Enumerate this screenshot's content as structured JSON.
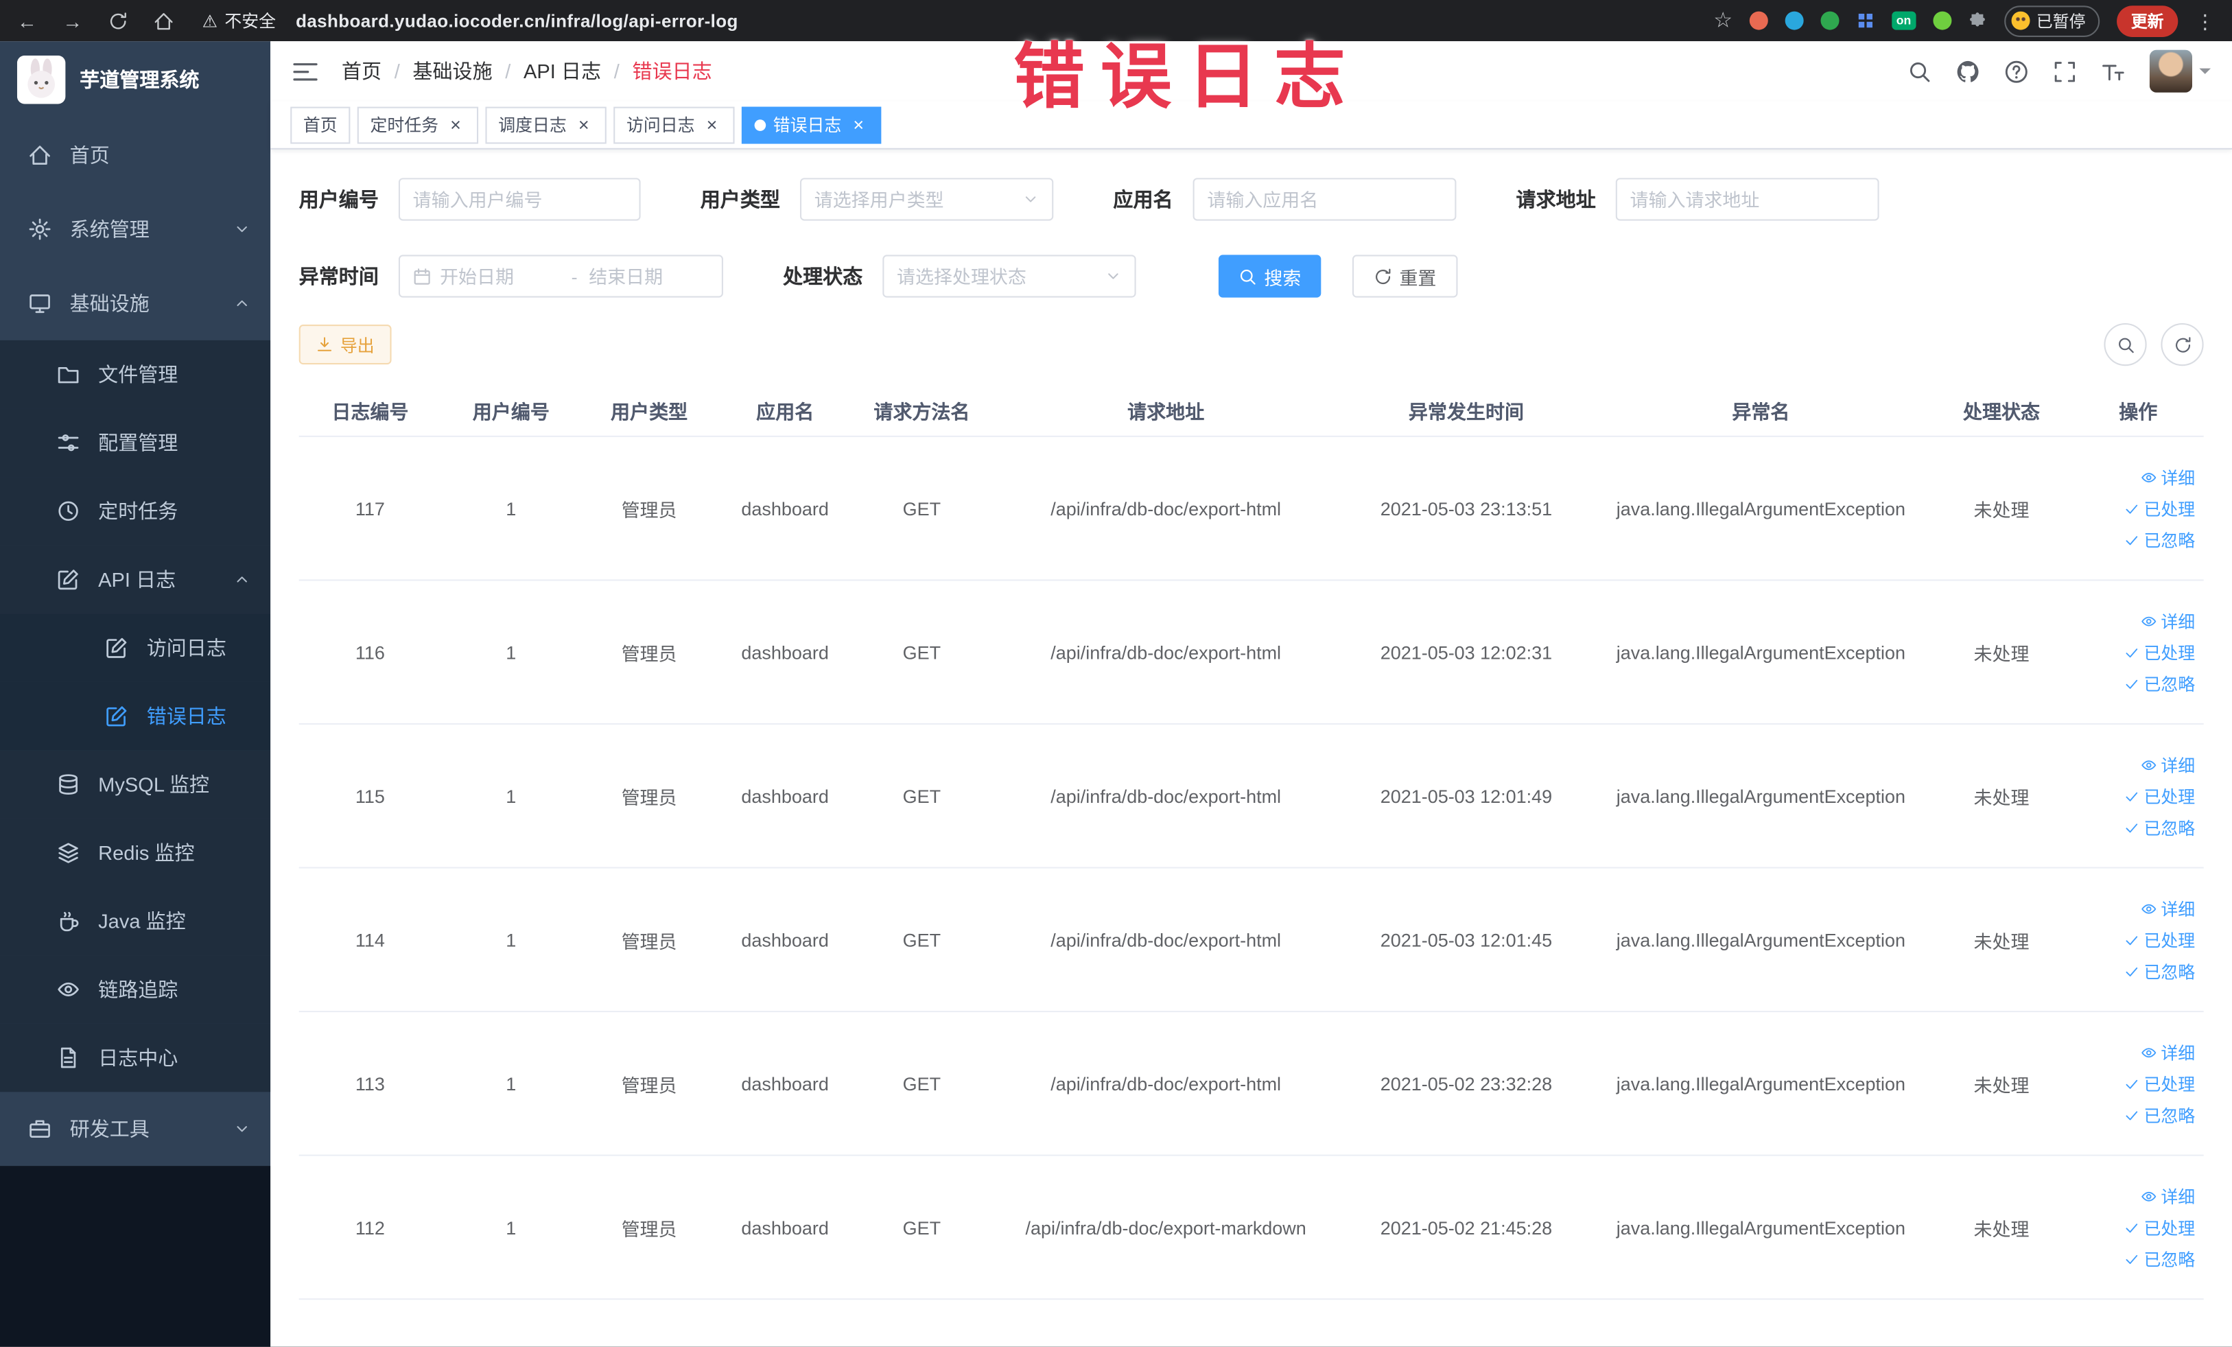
{
  "icons": {
    "back": "←",
    "forward": "→",
    "star": "☆",
    "warning": "⚠",
    "kebab": "⋮",
    "close": "×",
    "slash": "/"
  },
  "browser": {
    "security_label": "不安全",
    "url": "dashboard.yudao.iocoder.cn/infra/log/api-error-log",
    "paused_chip": "已暂停",
    "update_button": "更新",
    "on_badge": "on"
  },
  "overlay_title": "错误日志",
  "sidebar": {
    "logo_title": "芋道管理系统",
    "items": [
      {
        "label": "首页",
        "icon": "home-icon"
      },
      {
        "label": "系统管理",
        "icon": "gear-icon"
      },
      {
        "label": "基础设施",
        "icon": "monitor-icon"
      },
      {
        "label": "文件管理",
        "icon": "folder-icon"
      },
      {
        "label": "配置管理",
        "icon": "sliders-icon"
      },
      {
        "label": "定时任务",
        "icon": "clock-icon"
      },
      {
        "label": "API 日志",
        "icon": "edit-icon"
      },
      {
        "label": "访问日志",
        "icon": "document-icon"
      },
      {
        "label": "错误日志",
        "icon": "edit-icon"
      },
      {
        "label": "MySQL 监控",
        "icon": "database-icon"
      },
      {
        "label": "Redis 监控",
        "icon": "layers-icon"
      },
      {
        "label": "Java 监控",
        "icon": "cup-icon"
      },
      {
        "label": "链路追踪",
        "icon": "eye-icon"
      },
      {
        "label": "日志中心",
        "icon": "document-icon"
      },
      {
        "label": "研发工具",
        "icon": "toolbox-icon"
      }
    ]
  },
  "breadcrumb": {
    "items": [
      "首页",
      "基础设施",
      "API 日志",
      "错误日志"
    ]
  },
  "tabs": [
    {
      "label": "首页",
      "closable": false,
      "active": false
    },
    {
      "label": "定时任务",
      "closable": true,
      "active": false
    },
    {
      "label": "调度日志",
      "closable": true,
      "active": false
    },
    {
      "label": "访问日志",
      "closable": true,
      "active": false
    },
    {
      "label": "错误日志",
      "closable": true,
      "active": true
    }
  ],
  "filters": {
    "user_id": {
      "label": "用户编号",
      "placeholder": "请输入用户编号"
    },
    "user_type": {
      "label": "用户类型",
      "placeholder": "请选择用户类型"
    },
    "app_name": {
      "label": "应用名",
      "placeholder": "请输入应用名"
    },
    "request_url": {
      "label": "请求地址",
      "placeholder": "请输入请求地址"
    },
    "exception_time": {
      "label": "异常时间",
      "start_placeholder": "开始日期",
      "separator": "-",
      "end_placeholder": "结束日期"
    },
    "process_status": {
      "label": "处理状态",
      "placeholder": "请选择处理状态"
    },
    "search_button": "搜索",
    "reset_button": "重置"
  },
  "toolbar": {
    "export_button": "导出"
  },
  "table": {
    "columns": [
      "日志编号",
      "用户编号",
      "用户类型",
      "应用名",
      "请求方法名",
      "请求地址",
      "异常发生时间",
      "异常名",
      "处理状态",
      "操作"
    ],
    "actions": [
      "详细",
      "已处理",
      "已忽略"
    ],
    "rows": [
      {
        "log_id": "117",
        "user_id": "1",
        "user_type": "管理员",
        "app_name": "dashboard",
        "method": "GET",
        "url": "/api/infra/db-doc/export-html",
        "time": "2021-05-03 23:13:51",
        "exception": "java.lang.IllegalArgumentException",
        "status": "未处理"
      },
      {
        "log_id": "116",
        "user_id": "1",
        "user_type": "管理员",
        "app_name": "dashboard",
        "method": "GET",
        "url": "/api/infra/db-doc/export-html",
        "time": "2021-05-03 12:02:31",
        "exception": "java.lang.IllegalArgumentException",
        "status": "未处理"
      },
      {
        "log_id": "115",
        "user_id": "1",
        "user_type": "管理员",
        "app_name": "dashboard",
        "method": "GET",
        "url": "/api/infra/db-doc/export-html",
        "time": "2021-05-03 12:01:49",
        "exception": "java.lang.IllegalArgumentException",
        "status": "未处理"
      },
      {
        "log_id": "114",
        "user_id": "1",
        "user_type": "管理员",
        "app_name": "dashboard",
        "method": "GET",
        "url": "/api/infra/db-doc/export-html",
        "time": "2021-05-03 12:01:45",
        "exception": "java.lang.IllegalArgumentException",
        "status": "未处理"
      },
      {
        "log_id": "113",
        "user_id": "1",
        "user_type": "管理员",
        "app_name": "dashboard",
        "method": "GET",
        "url": "/api/infra/db-doc/export-html",
        "time": "2021-05-02 23:32:28",
        "exception": "java.lang.IllegalArgumentException",
        "status": "未处理"
      },
      {
        "log_id": "112",
        "user_id": "1",
        "user_type": "管理员",
        "app_name": "dashboard",
        "method": "GET",
        "url": "/api/infra/db-doc/export-markdown",
        "time": "2021-05-02 21:45:28",
        "exception": "java.lang.IllegalArgumentException",
        "status": "未处理"
      }
    ]
  }
}
